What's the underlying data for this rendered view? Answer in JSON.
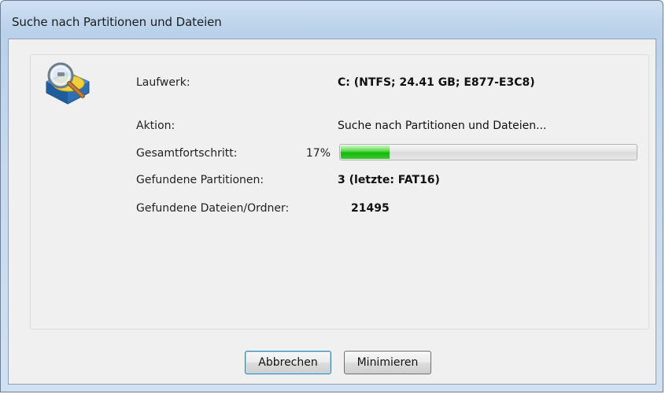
{
  "window": {
    "title": "Suche nach Partitionen und Dateien"
  },
  "icon": "drive-search-icon",
  "fields": {
    "drive_label": "Laufwerk:",
    "drive_value": "C: (NTFS; 24.41 GB; E877-E3C8)",
    "action_label": "Aktion:",
    "action_value": "Suche nach Partitionen und Dateien...",
    "progress_label": "Gesamtfortschritt:",
    "progress_percent_text": "17%",
    "progress_value": 0.17,
    "partitions_label": "Gefundene Partitionen:",
    "partitions_value": "3 (letzte: FAT16)",
    "files_label": "Gefundene Dateien/Ordner:",
    "files_value": "21495"
  },
  "buttons": {
    "cancel_label": "Abbrechen",
    "minimize_label": "Minimieren"
  },
  "colors": {
    "progress_green": "#16b70c",
    "title_bar": "#c6d9ee",
    "client_bg": "#f0f0f0"
  }
}
